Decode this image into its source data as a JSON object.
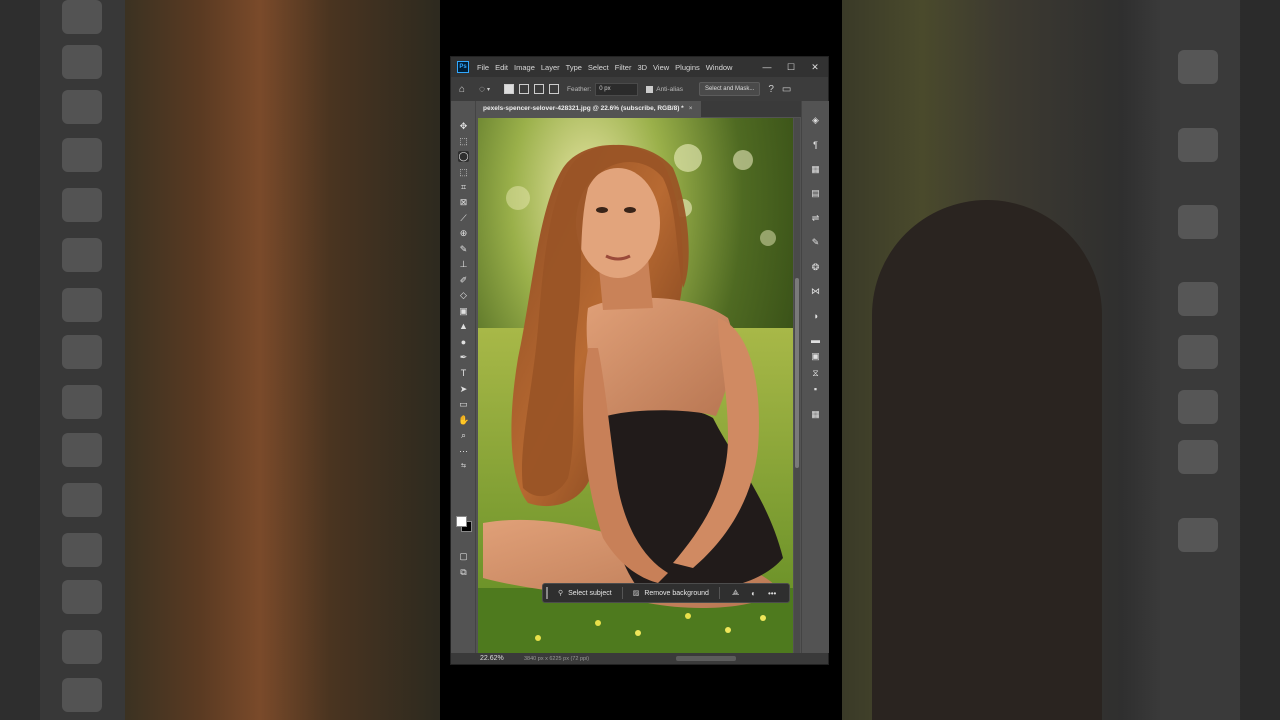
{
  "app": {
    "logo_text": "Ps",
    "menu": [
      "File",
      "Edit",
      "Image",
      "Layer",
      "Type",
      "Select",
      "Filter",
      "3D",
      "View",
      "Plugins",
      "Window"
    ],
    "window_controls": {
      "minimize": "—",
      "maximize": "☐",
      "close": "✕"
    }
  },
  "options_bar": {
    "feather_label": "Feather:",
    "feather_value": "0 px",
    "anti_alias_label": "Anti-alias",
    "anti_alias_checked": true,
    "select_mask_label": "Select and Mask..."
  },
  "document_tab": {
    "title": "pexels-spencer-selover-428321.jpg @ 22.6% (subscribe, RGB/8) *",
    "close": "×"
  },
  "contextual_task_bar": {
    "select_subject_label": "Select subject",
    "remove_background_label": "Remove background",
    "more_label": "•••"
  },
  "status_bar": {
    "zoom": "22.62%",
    "document_size": "3840 px x 6225 px (72 ppi)"
  },
  "icons": {
    "home": "home-icon",
    "lasso": "lasso-icon",
    "help": "help-icon",
    "workspace": "workspace-icon"
  },
  "colors": {
    "foreground": "#ffffff",
    "background": "#000000",
    "accent": "#31a8ff"
  }
}
